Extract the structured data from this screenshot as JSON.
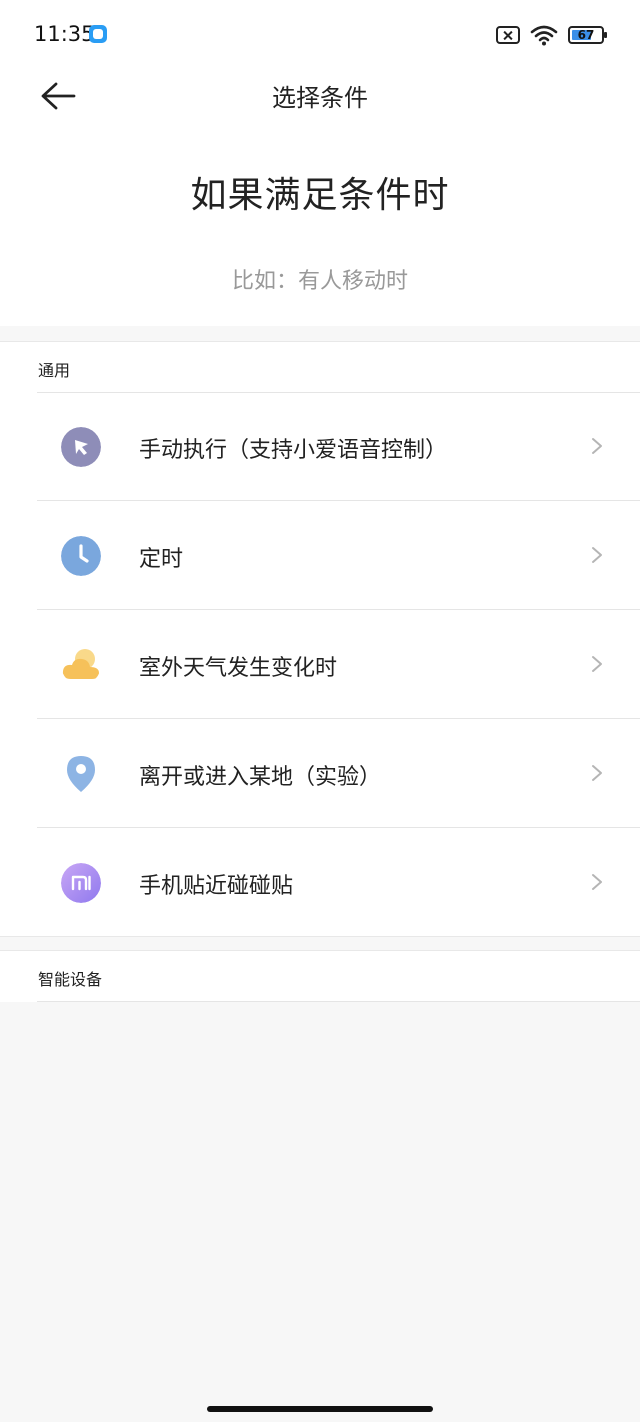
{
  "status_bar": {
    "time": "11:35",
    "battery_level": "67",
    "battery_fraction": 0.67,
    "icons": [
      "app-badge-icon",
      "no-sim-icon",
      "wifi-icon",
      "battery-icon"
    ]
  },
  "header": {
    "back_icon": "arrow-left-icon",
    "title": "选择条件",
    "hero_title": "如果满足条件时",
    "hero_subtitle": "比如：有人移动时"
  },
  "sections": {
    "general": {
      "label": "通用",
      "items": [
        {
          "label": "手动执行（支持小爱语音控制）",
          "icon": "pointer-icon",
          "color": "#8e8db8"
        },
        {
          "label": "定时",
          "icon": "clock-icon",
          "color": "#7aa7dd"
        },
        {
          "label": "室外天气发生变化时",
          "icon": "weather-icon",
          "color": "#f6c15a"
        },
        {
          "label": "离开或进入某地（实验）",
          "icon": "location-pin-icon",
          "color": "#8db4e4"
        },
        {
          "label": "手机贴近碰碰贴",
          "icon": "mi-icon",
          "color": "#a88df0"
        }
      ]
    },
    "devices": {
      "label": "智能设备"
    }
  }
}
